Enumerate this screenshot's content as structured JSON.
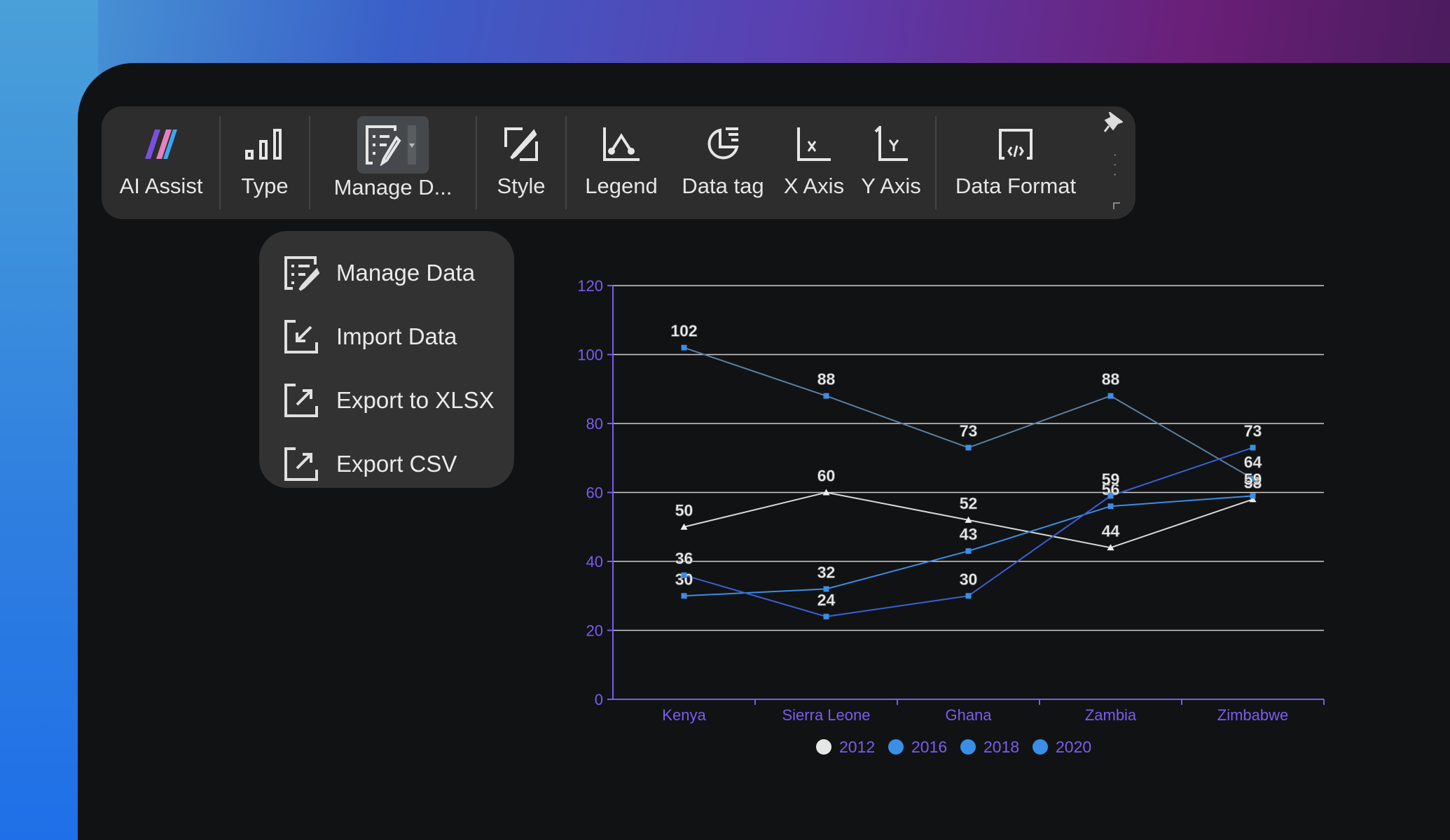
{
  "toolbar": {
    "items": [
      {
        "label": "AI Assist",
        "icon": "ai-assist-logo"
      },
      {
        "label": "Type",
        "icon": "bar-chart-icon"
      },
      {
        "label": "Manage D...",
        "icon": "manage-data-icon"
      },
      {
        "label": "Style",
        "icon": "style-brush-icon"
      },
      {
        "label": "Legend",
        "icon": "legend-icon"
      },
      {
        "label": "Data tag",
        "icon": "data-tag-pie-icon"
      },
      {
        "label": "X Axis",
        "icon": "x-axis-icon"
      },
      {
        "label": "Y Axis",
        "icon": "y-axis-icon"
      },
      {
        "label": "Data Format",
        "icon": "data-format-code-icon"
      }
    ]
  },
  "menu": {
    "items": [
      {
        "label": "Manage Data",
        "icon": "manage-data-icon"
      },
      {
        "label": "Import Data",
        "icon": "import-icon"
      },
      {
        "label": "Export to XLSX",
        "icon": "export-icon"
      },
      {
        "label": "Export CSV",
        "icon": "export-icon"
      }
    ]
  },
  "chart_data": {
    "type": "line",
    "categories": [
      "Kenya",
      "Sierra Leone",
      "Ghana",
      "Zambia",
      "Zimbabwe"
    ],
    "ylim": [
      0,
      120
    ],
    "yticks": [
      0,
      20,
      40,
      60,
      80,
      100,
      120
    ],
    "grid": true,
    "legend_position": "bottom",
    "data_labels": true,
    "axis_color": "#7b5cf0",
    "series": [
      {
        "name": "2012",
        "values": [
          50,
          60,
          52,
          44,
          58
        ],
        "color": "#d8d8d8",
        "marker": "triangle",
        "legend_color": "#e6e6e6"
      },
      {
        "name": "2016",
        "values": [
          102,
          88,
          73,
          88,
          64
        ],
        "color": "#5d7f9e",
        "marker": "square",
        "legend_color": "#3a8ee6"
      },
      {
        "name": "2018",
        "values": [
          30,
          32,
          43,
          56,
          59
        ],
        "color": "#3a8ee6",
        "marker": "square",
        "legend_color": "#3a8ee6"
      },
      {
        "name": "2020",
        "values": [
          36,
          24,
          30,
          59,
          73
        ],
        "color": "#3b5fd6",
        "marker": "square",
        "legend_color": "#3a8ee6"
      }
    ]
  }
}
